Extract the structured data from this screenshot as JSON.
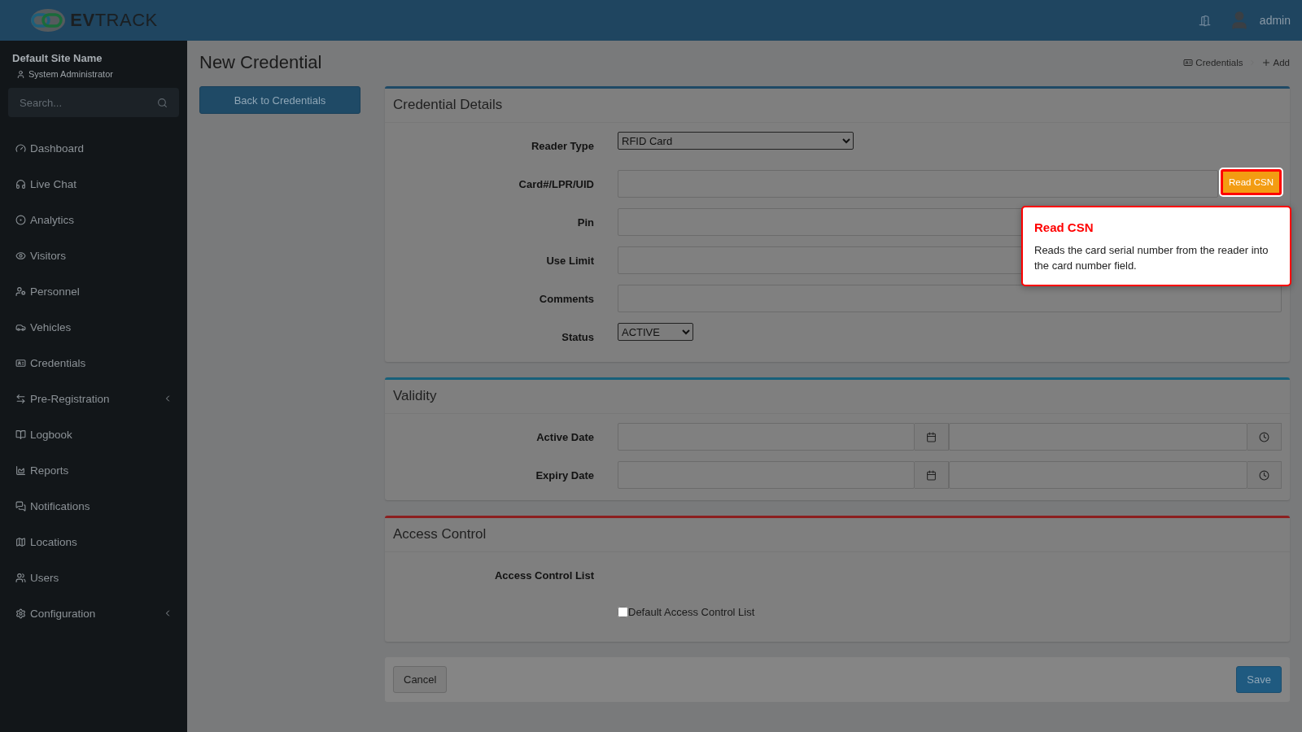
{
  "brand": {
    "name": "**EV**TRACK"
  },
  "topbar": {
    "user": "admin"
  },
  "site": {
    "name": "Default Site Name",
    "role": "System Administrator"
  },
  "search": {
    "placeholder": "Search..."
  },
  "nav": [
    {
      "label": "Dashboard",
      "submenu": false
    },
    {
      "label": "Live Chat",
      "submenu": false
    },
    {
      "label": "Analytics",
      "submenu": false
    },
    {
      "label": "Visitors",
      "submenu": false
    },
    {
      "label": "Personnel",
      "submenu": false
    },
    {
      "label": "Vehicles",
      "submenu": false
    },
    {
      "label": "Credentials",
      "submenu": false
    },
    {
      "label": "Pre-Registration",
      "submenu": true
    },
    {
      "label": "Logbook",
      "submenu": false
    },
    {
      "label": "Reports",
      "submenu": false
    },
    {
      "label": "Notifications",
      "submenu": false
    },
    {
      "label": "Locations",
      "submenu": false
    },
    {
      "label": "Users",
      "submenu": false
    },
    {
      "label": "Configuration",
      "submenu": true
    }
  ],
  "page": {
    "title": "New Credential",
    "back_button": "Back to Credentials"
  },
  "breadcrumb": [
    {
      "label": "Credentials"
    },
    {
      "label": "Add"
    }
  ],
  "sections": [
    {
      "title": "Credential Details",
      "color": "#1f4a66",
      "fields": [
        {
          "label": "Reader Type",
          "kind": "select",
          "value": "RFID Card"
        },
        {
          "label": "Card#/LPR/UID",
          "kind": "input_button",
          "button": "Read CSN",
          "highlighted": true
        },
        {
          "label": "Pin",
          "kind": "input"
        },
        {
          "label": "Use Limit",
          "kind": "input"
        },
        {
          "label": "Comments",
          "kind": "input"
        },
        {
          "label": "Status",
          "kind": "select_small",
          "value": "ACTIVE"
        }
      ]
    },
    {
      "title": "Validity",
      "color": "#17607a",
      "fields": [
        {
          "label": "Active Date",
          "kind": "datetime"
        },
        {
          "label": "Expiry Date",
          "kind": "datetime"
        }
      ]
    },
    {
      "title": "Access Control",
      "color": "#8c1f1f",
      "fields": [
        {
          "label": "Access Control List",
          "kind": "heading"
        },
        {
          "kind": "checkbox",
          "text": "Default Access Control List",
          "checked": false
        }
      ]
    }
  ],
  "tooltip": {
    "title": "Read CSN",
    "text": "Reads the card serial number from the reader into the card number field."
  },
  "footer": {
    "cancel": "Cancel",
    "save": "Save"
  }
}
